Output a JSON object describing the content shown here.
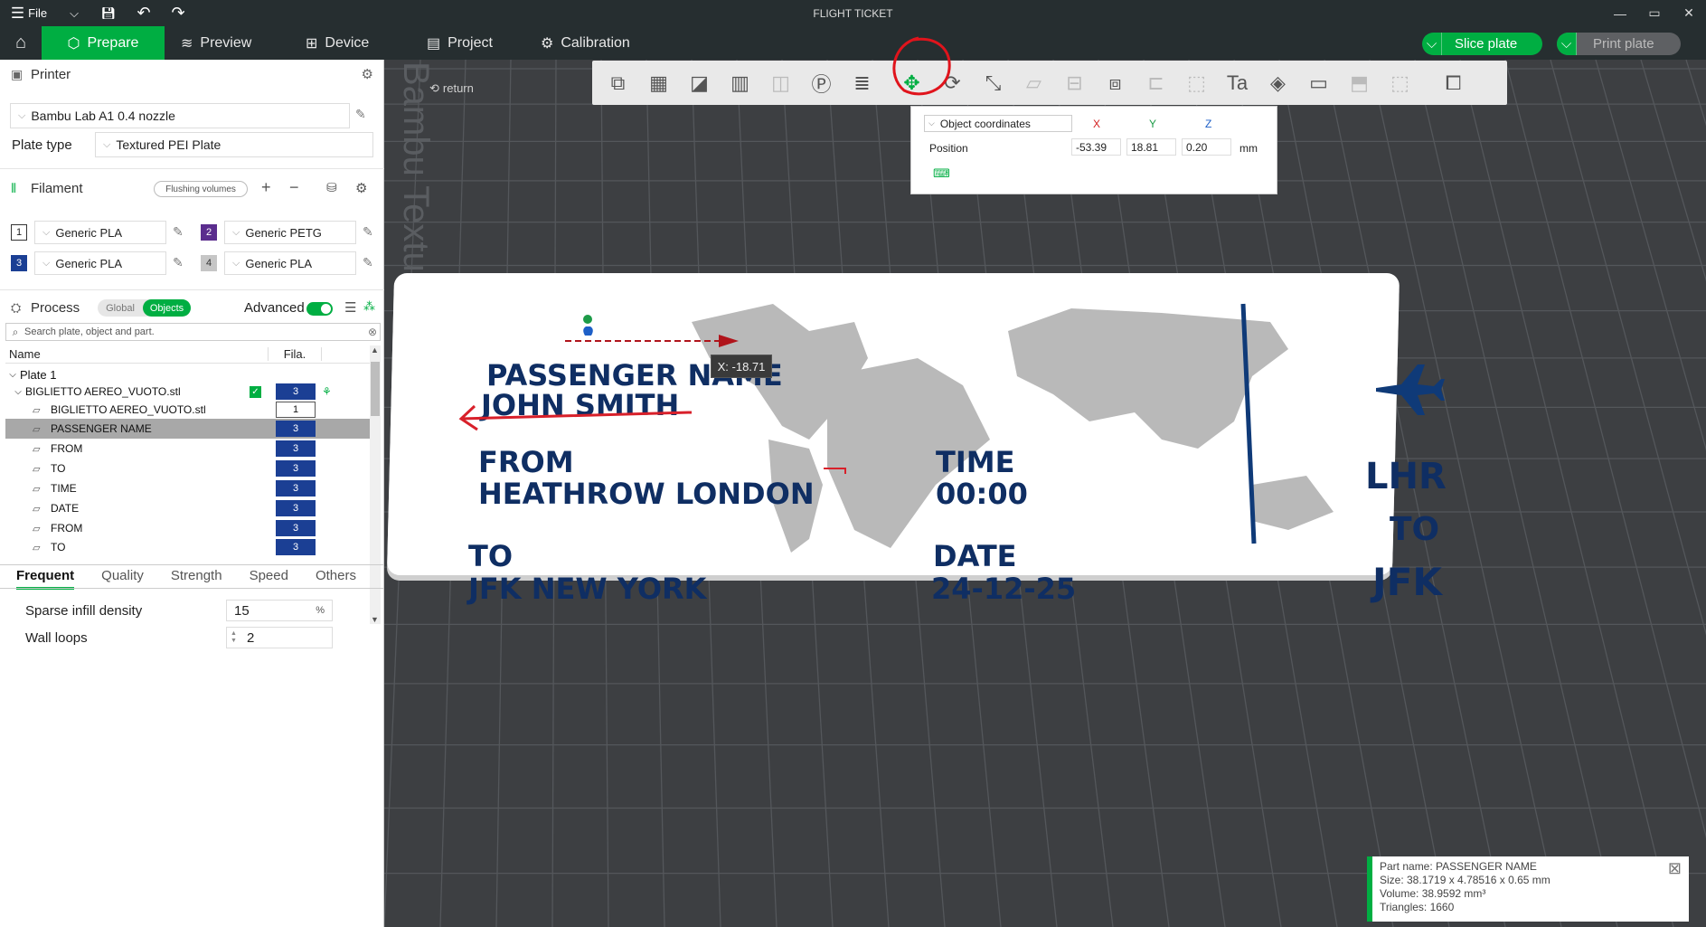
{
  "titlebar": {
    "menu_label": "File",
    "title": "FLIGHT TICKET"
  },
  "tabs": [
    {
      "label": "Prepare"
    },
    {
      "label": "Preview"
    },
    {
      "label": "Device"
    },
    {
      "label": "Project"
    },
    {
      "label": "Calibration"
    }
  ],
  "actions": {
    "slice": "Slice plate",
    "print": "Print plate"
  },
  "printer": {
    "section": "Printer",
    "name": "Bambu Lab A1 0.4 nozzle",
    "plate_type_label": "Plate type",
    "plate_type": "Textured PEI Plate"
  },
  "filament": {
    "section": "Filament",
    "flushing": "Flushing volumes",
    "slots": [
      {
        "num": "1",
        "name": "Generic PLA",
        "color": "#ffffff"
      },
      {
        "num": "2",
        "name": "Generic PETG",
        "color": "#5b2d8e"
      },
      {
        "num": "3",
        "name": "Generic PLA",
        "color": "#1b3f94"
      },
      {
        "num": "4",
        "name": "Generic PLA",
        "color": "#c6c6c6"
      }
    ]
  },
  "process": {
    "section": "Process",
    "global": "Global",
    "objects": "Objects",
    "advanced": "Advanced",
    "search_placeholder": "Search plate, object and part."
  },
  "tree": {
    "col_name": "Name",
    "col_fila": "Fila.",
    "plate": "Plate 1",
    "object": "BIGLIETTO AEREO_VUOTO.stl",
    "object_fila": "3",
    "parts": [
      {
        "name": "BIGLIETTO AEREO_VUOTO.stl",
        "fila": "1"
      },
      {
        "name": "PASSENGER NAME",
        "fila": "3"
      },
      {
        "name": "FROM",
        "fila": "3"
      },
      {
        "name": "TO",
        "fila": "3"
      },
      {
        "name": "TIME",
        "fila": "3"
      },
      {
        "name": "DATE",
        "fila": "3"
      },
      {
        "name": "FROM",
        "fila": "3"
      },
      {
        "name": "TO",
        "fila": "3"
      }
    ]
  },
  "param_tabs": [
    "Frequent",
    "Quality",
    "Strength",
    "Speed",
    "Others"
  ],
  "params": {
    "infill_label": "Sparse infill density",
    "infill_value": "15",
    "infill_unit": "%",
    "walls_label": "Wall loops",
    "walls_value": "2"
  },
  "canvas": {
    "return": "return",
    "plate_watermark": "Bambu Textured PEI Plate",
    "tooltip": "X: -18.71"
  },
  "popup": {
    "coords": "Object coordinates",
    "x_label": "X",
    "y_label": "Y",
    "z_label": "Z",
    "position_label": "Position",
    "x": "-53.39",
    "y": "18.81",
    "z": "0.20",
    "unit": "mm"
  },
  "ticket": {
    "passenger_label": "PASSENGER NAME",
    "passenger": "JOHN SMITH",
    "from_label": "FROM",
    "from": "HEATHROW LONDON",
    "to_label": "TO",
    "to": "JFK NEW YORK",
    "time_label": "TIME",
    "time": "00:00",
    "date_label": "DATE",
    "date": "24-12-25",
    "origin": "LHR",
    "to_word": "TO",
    "dest": "JFK"
  },
  "info": {
    "part": "Part name: PASSENGER NAME",
    "size": "Size: 38.1719 x 4.78516 x 0.65 mm",
    "volume": "Volume: 38.9592 mm³",
    "triangles": "Triangles: 1660"
  },
  "colors": {
    "accent": "#00ae42",
    "dark": "#262e30",
    "ticket_text": "#0f2e63"
  }
}
